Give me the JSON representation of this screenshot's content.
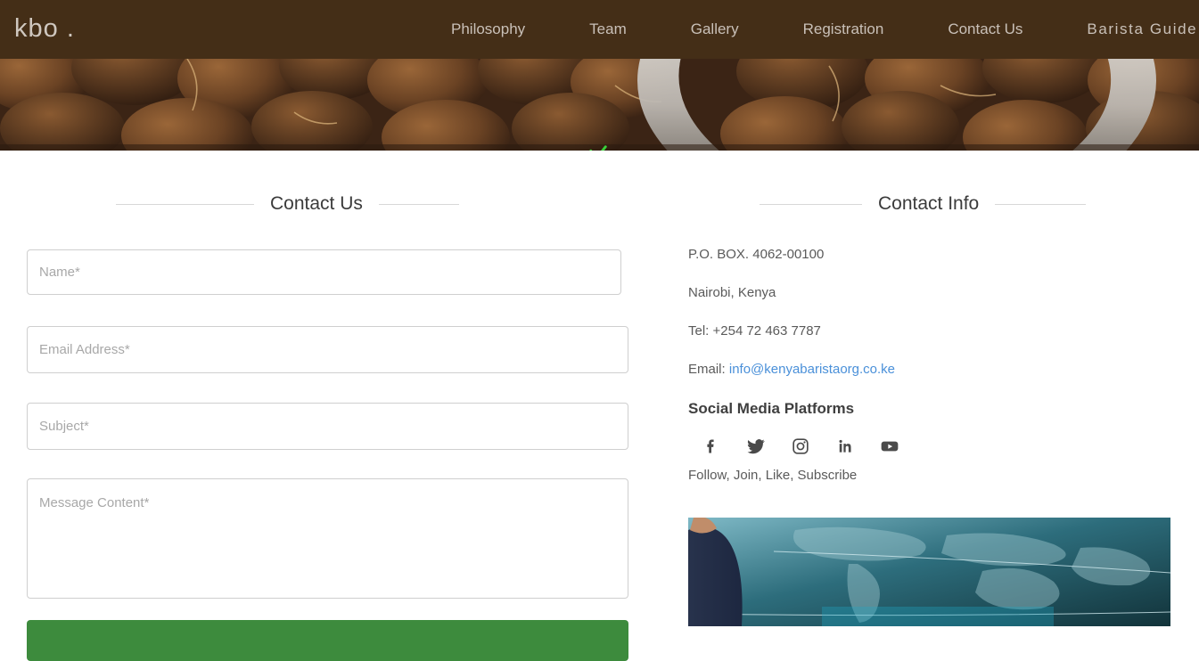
{
  "header": {
    "logo": "kbo .",
    "background_color": "#442e17",
    "nav": [
      {
        "label": "Philosophy",
        "name": "nav-philosophy"
      },
      {
        "label": "Team",
        "name": "nav-team"
      },
      {
        "label": "Gallery",
        "name": "nav-gallery"
      },
      {
        "label": "Registration",
        "name": "nav-registration"
      },
      {
        "label": "Contact Us",
        "name": "nav-contact-us"
      }
    ],
    "dropdown": {
      "label": "Barista Guide",
      "icon": "chevron-down-icon"
    }
  },
  "hero": {
    "alt": "roasted coffee beans in a white cup",
    "overlay_icon": "check-icon",
    "overlay_icon_color": "#3bd13b"
  },
  "form_section": {
    "heading": "Contact Us",
    "fields": {
      "name_placeholder": "Name*",
      "email_placeholder": "Email Address*",
      "subject_placeholder": "Subject*",
      "message_placeholder": "Message Content*",
      "name_value": "",
      "email_value": "",
      "subject_value": "",
      "message_value": ""
    },
    "submit_label": "",
    "submit_color": "#3d8b3d"
  },
  "info_section": {
    "heading": "Contact Info",
    "po_box": "P.O. BOX. 4062-00100",
    "city": "Nairobi, Kenya",
    "tel": "Tel: +254 72 463 7787",
    "email_label": "Email:",
    "email_address": "info@kenyabaristaorg.co.ke",
    "email_color": "#4a90d9",
    "social_title": "Social Media Platforms",
    "social_icons": [
      {
        "name": "facebook-icon",
        "label": "Facebook"
      },
      {
        "name": "twitter-icon",
        "label": "Twitter"
      },
      {
        "name": "instagram-icon",
        "label": "Instagram"
      },
      {
        "name": "linkedin-icon",
        "label": "LinkedIn"
      },
      {
        "name": "youtube-icon",
        "label": "YouTube"
      }
    ],
    "follow_text": "Follow, Join, Like, Subscribe",
    "promo_alt": "person in front of a world map graphic"
  }
}
